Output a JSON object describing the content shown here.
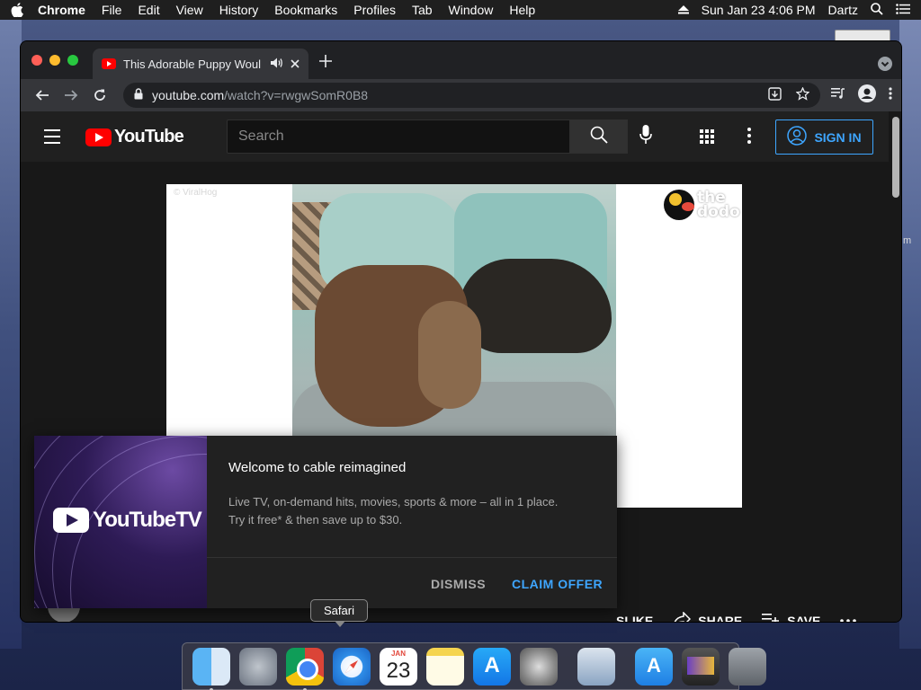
{
  "menubar": {
    "app": "Chrome",
    "menus": [
      "File",
      "Edit",
      "View",
      "History",
      "Bookmarks",
      "Profiles",
      "Tab",
      "Window",
      "Help"
    ],
    "datetime": "Sun Jan 23  4:06 PM",
    "user": "Dartz"
  },
  "browser": {
    "tab_title": "This Adorable Puppy Woul",
    "url_host": "youtube.com",
    "url_path": "/watch?v=rwgwSomR0B8"
  },
  "youtube": {
    "logo_text": "YouTube",
    "search_placeholder": "Search",
    "signin_label": "SIGN IN",
    "video_watermark": "© ViralHog",
    "dodo_line1": "the",
    "dodo_line2": "dodo",
    "actions": {
      "like": "SLIKE",
      "share": "SHARE",
      "save": "SAVE"
    }
  },
  "promo": {
    "logo_text": "YouTubeTV",
    "headline": "Welcome to cable reimagined",
    "desc_line1": "Live TV, on-demand hits, movies, sports & more – all in 1 place.",
    "desc_line2": "Try it free* & then save up to $30.",
    "dismiss": "DISMISS",
    "claim": "CLAIM OFFER"
  },
  "dock": {
    "tooltip": "Safari",
    "calendar_month": "JAN",
    "calendar_day": "23"
  },
  "desktop": {
    "edge_letter": "m"
  },
  "colors": {
    "yt_red": "#ff0000",
    "link_blue": "#3ea6ff",
    "page_bg": "#181818"
  }
}
